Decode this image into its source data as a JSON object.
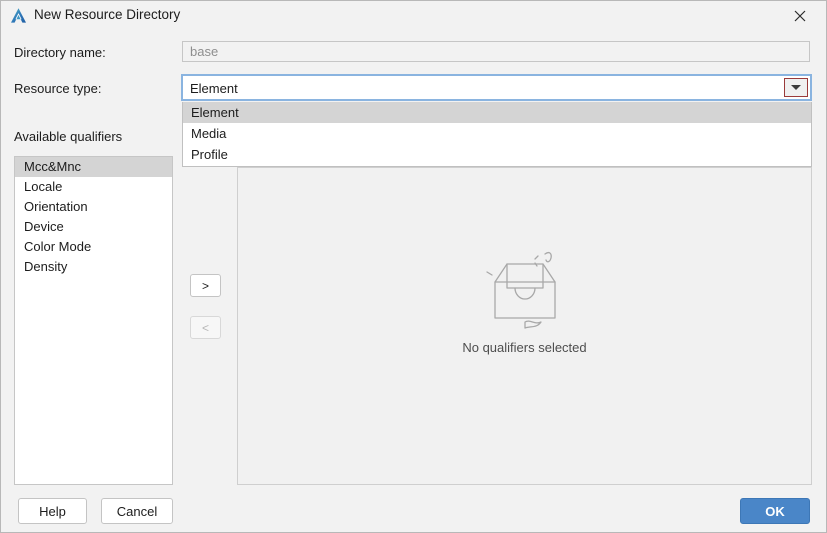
{
  "window": {
    "title": "New Resource Directory",
    "app_icon": "deveco-logo-icon",
    "close_icon": "close-icon"
  },
  "form": {
    "directory_name_label": "Directory name:",
    "directory_name_value": "base",
    "resource_type_label": "Resource type:",
    "resource_type_value": "Element",
    "resource_type_options": [
      "Element",
      "Media",
      "Profile"
    ],
    "resource_type_selected_index": 0,
    "dropdown_arrow_icon": "chevron-down-icon",
    "dropdown_highlight_color": "#9a3a3a",
    "focus_border_color": "#8ab4e0"
  },
  "qualifiers": {
    "available_label": "Available qualifiers",
    "items": [
      "Mcc&Mnc",
      "Locale",
      "Orientation",
      "Device",
      "Color Mode",
      "Density"
    ],
    "selected_index": 0,
    "add_button_label": ">",
    "remove_button_label": "<",
    "add_button_enabled": true,
    "remove_button_enabled": false
  },
  "selected_panel": {
    "empty_text": "No qualifiers selected",
    "empty_illustration_icon": "empty-box-icon"
  },
  "footer": {
    "help_label": "Help",
    "cancel_label": "Cancel",
    "ok_label": "OK",
    "ok_accent_color": "#4a86c8"
  }
}
